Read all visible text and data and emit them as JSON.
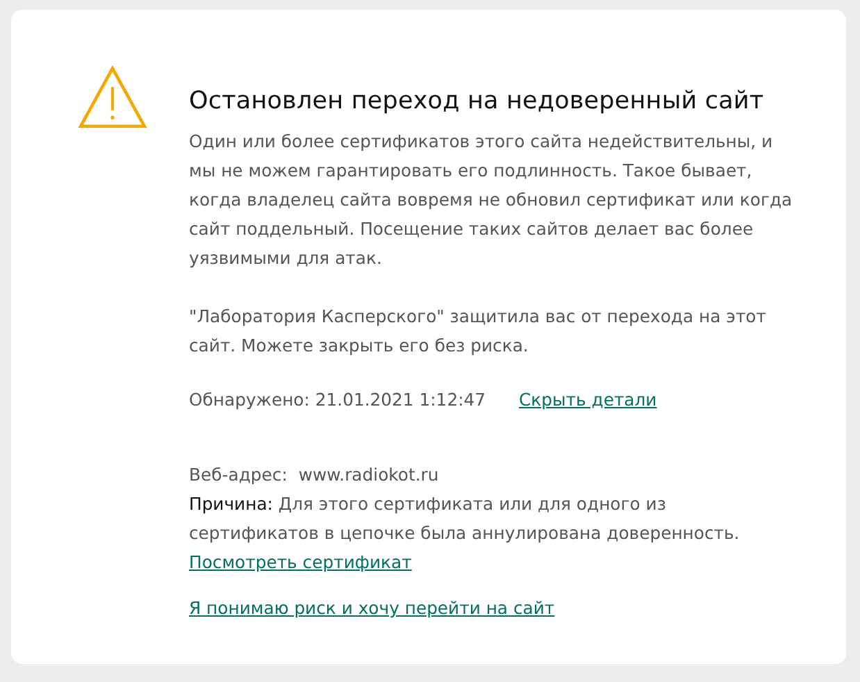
{
  "dialog": {
    "title": "Остановлен переход на недоверенный сайт",
    "paragraphs": [
      "Один или более сертификатов этого сайта недействительны, и мы не можем гарантировать его подлинность. Такое бывает, когда владелец сайта вовремя не обновил сертификат или когда сайт поддельный. Посещение таких сайтов делает вас более уязвимыми для атак.",
      "\"Лаборатория Касперского\" защитила вас от перехода на этот сайт. Можете закрыть его без риска."
    ],
    "detected": "Обнаружено: 21.01.2021 1:12:47",
    "details_link": "Скрыть детали",
    "web_address": {
      "label": "Веб-адрес:",
      "value": "www.radiokot.ru"
    },
    "reason": {
      "label": "Причина:",
      "text": "Для этого сертификата или для одного из сертификатов в цепочке была аннулирована доверенность.",
      "link": "Посмотреть сертификат"
    },
    "proceed_link": "Я понимаю риск и хочу перейти на сайт"
  }
}
